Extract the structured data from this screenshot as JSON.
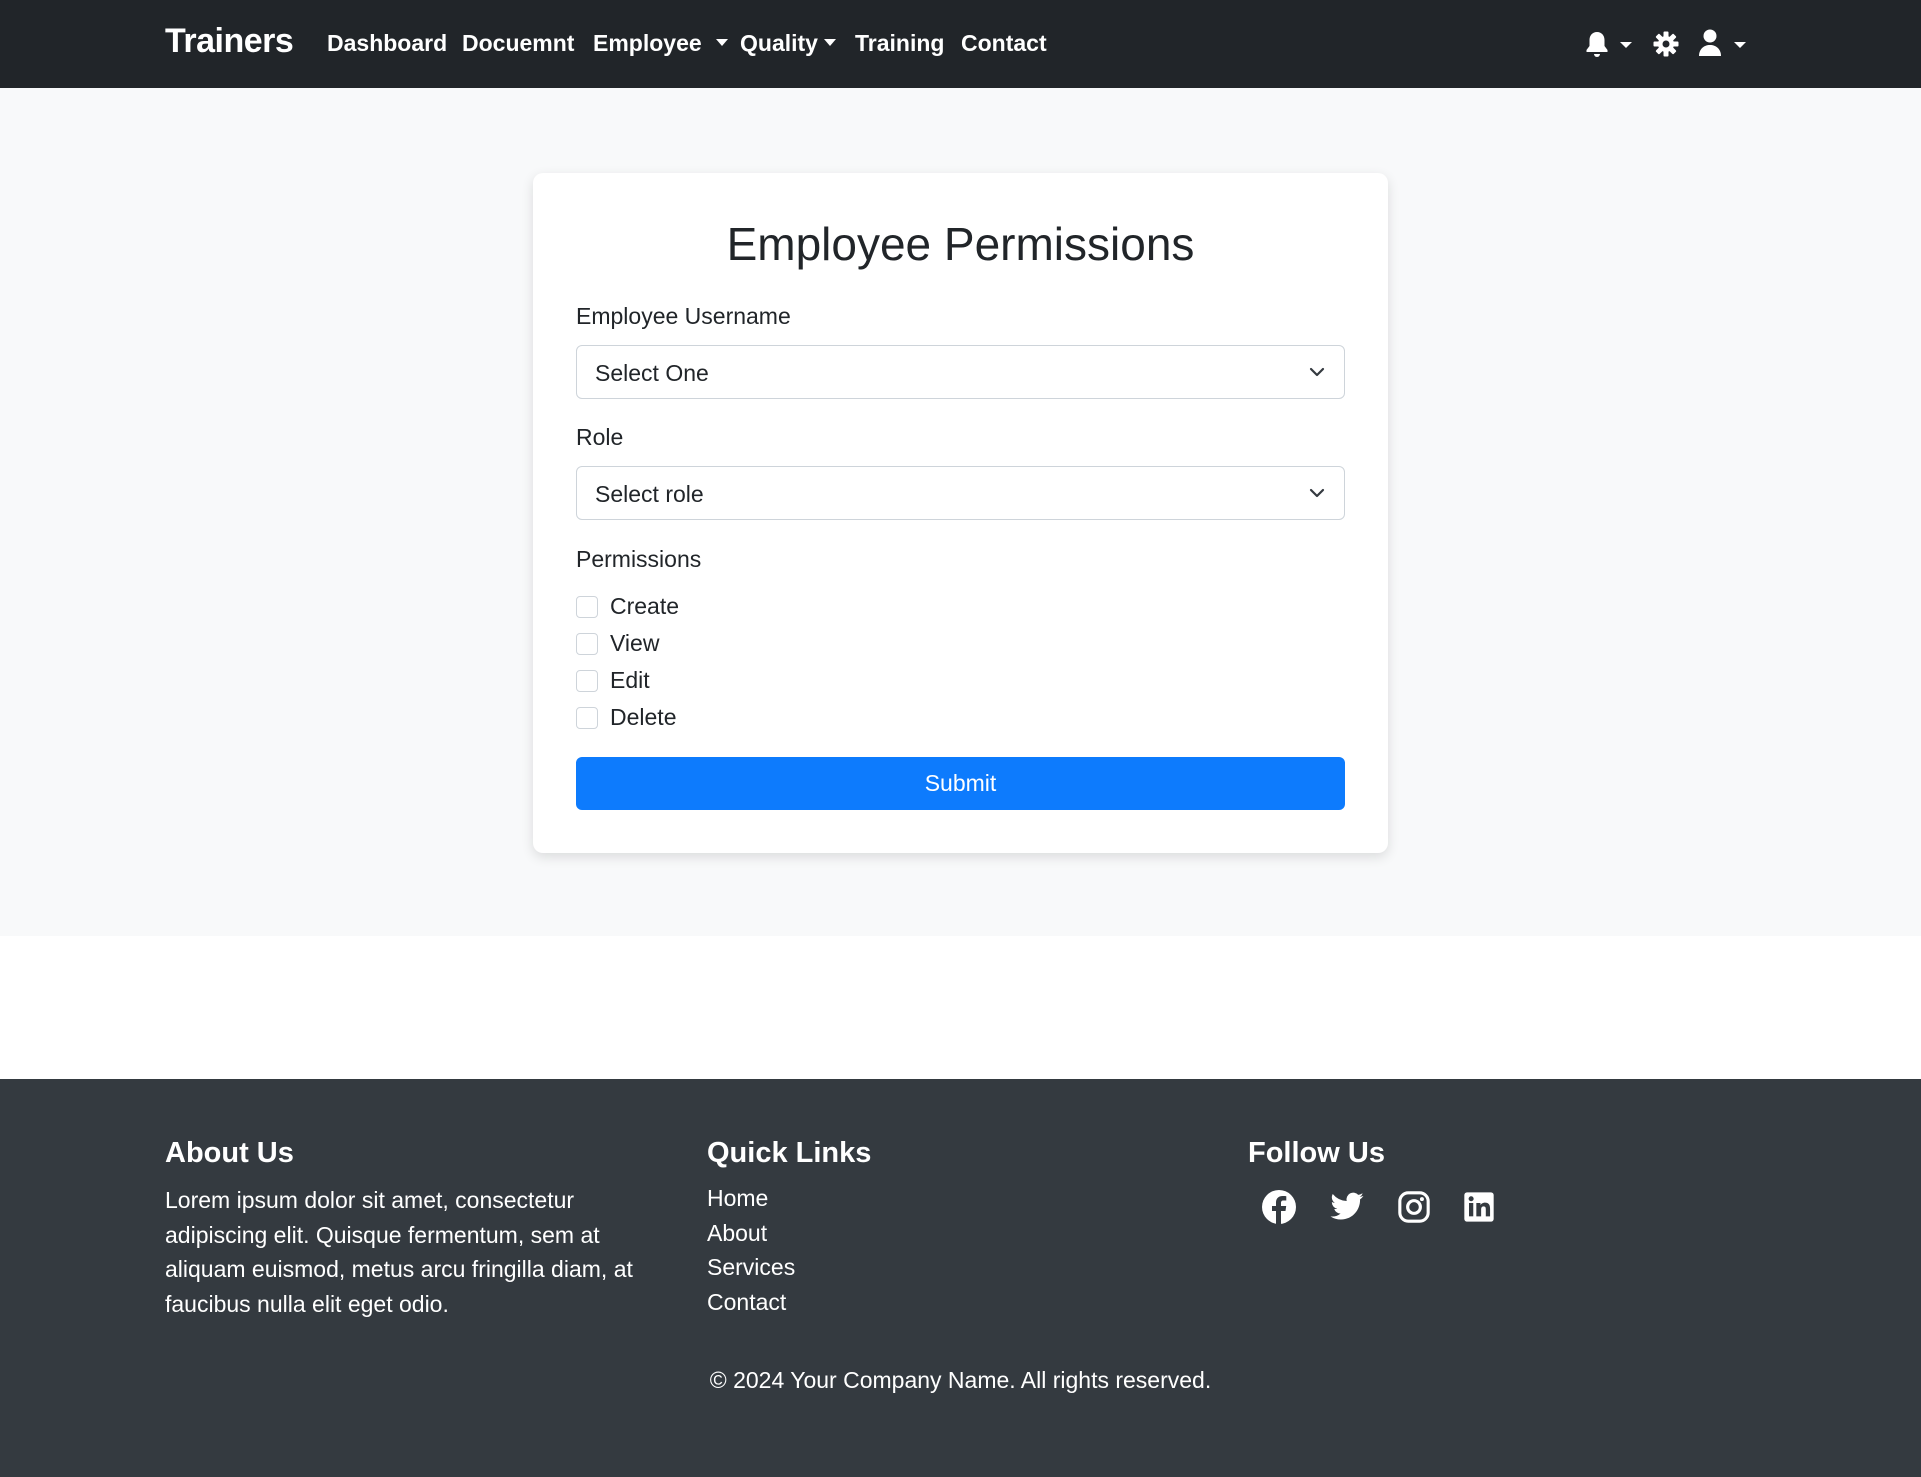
{
  "navbar": {
    "brand": "Trainers",
    "links": [
      {
        "label": "Dashboard"
      },
      {
        "label": "Docuemnt"
      },
      {
        "label": "Employee"
      },
      {
        "label": "Quality"
      },
      {
        "label": "Training"
      },
      {
        "label": "Contact"
      }
    ],
    "icons": [
      "bell-icon",
      "gear-icon",
      "user-icon"
    ]
  },
  "form": {
    "title": "Employee Permissions",
    "username_label": "Employee Username",
    "username_value": "Select One",
    "role_label": "Role",
    "role_value": "Select role",
    "permissions_label": "Permissions",
    "permissions": [
      {
        "label": "Create",
        "checked": false
      },
      {
        "label": "View",
        "checked": false
      },
      {
        "label": "Edit",
        "checked": false
      },
      {
        "label": "Delete",
        "checked": false
      }
    ],
    "submit_label": "Submit",
    "accent_color": "#0d7bfd"
  },
  "footer": {
    "about_heading": "About Us",
    "about_text": "Lorem ipsum dolor sit amet, consectetur adipiscing elit. Quisque fermentum, sem at aliquam euismod, metus arcu fringilla diam, at faucibus nulla elit eget odio.",
    "links_heading": "Quick Links",
    "links": [
      "Home",
      "About",
      "Services",
      "Contact"
    ],
    "follow_heading": "Follow Us",
    "social_icons": [
      "facebook-icon",
      "twitter-icon",
      "instagram-icon",
      "linkedin-icon"
    ],
    "copyright": "© 2024 Your Company Name. All rights reserved."
  }
}
